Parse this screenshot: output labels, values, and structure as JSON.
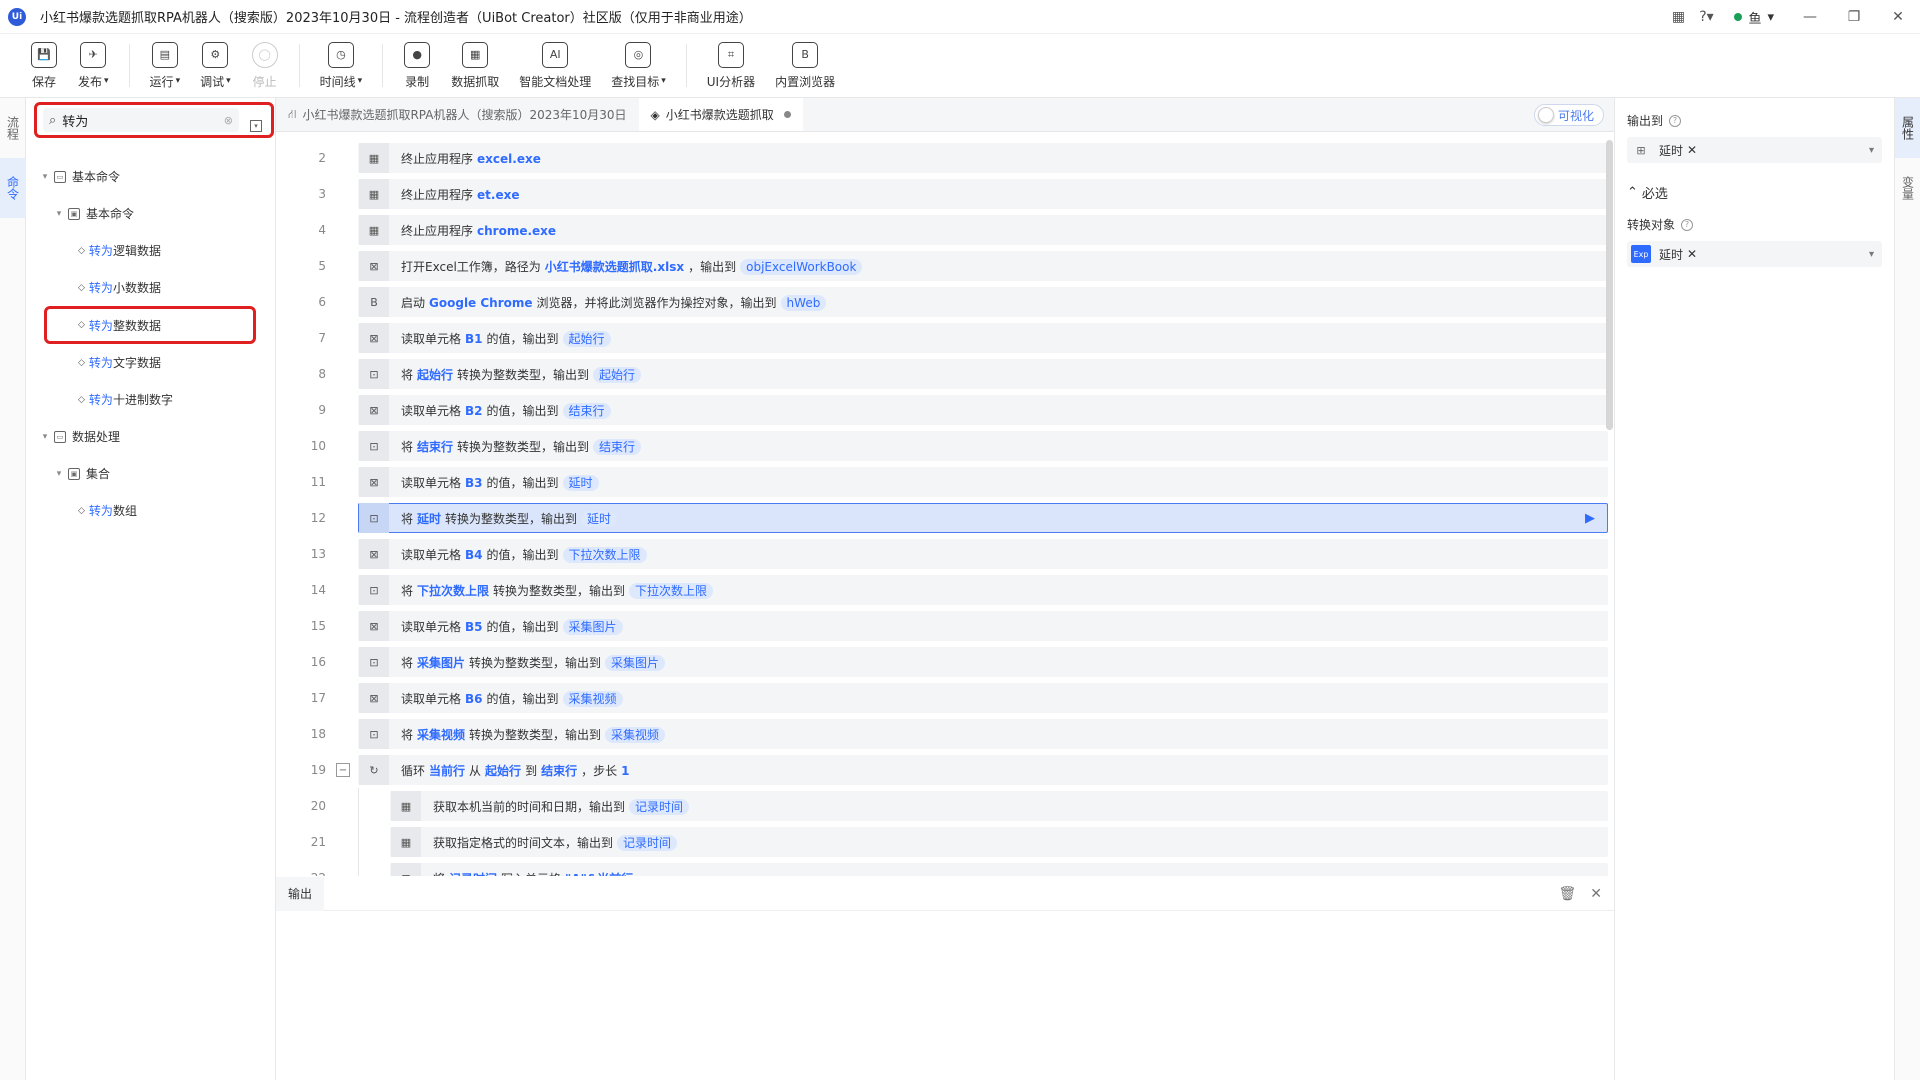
{
  "window": {
    "logo": "Ui",
    "title": "小红书爆款选题抓取RPA机器人（搜索版）2023年10月30日 - 流程创造者（UiBot Creator）社区版（仅用于非商业用途）",
    "user": "鱼"
  },
  "toolbar": {
    "items": [
      {
        "label": "保存",
        "icon": "save-icon",
        "caret": false,
        "disabled": false
      },
      {
        "label": "发布",
        "icon": "send-icon",
        "caret": true,
        "disabled": false
      },
      {
        "sep": true
      },
      {
        "label": "运行",
        "icon": "run-icon",
        "caret": true,
        "disabled": false
      },
      {
        "label": "调试",
        "icon": "debug-icon",
        "caret": true,
        "disabled": false
      },
      {
        "label": "停止",
        "icon": "stop-icon",
        "caret": false,
        "disabled": true
      },
      {
        "sep": true
      },
      {
        "label": "时间线",
        "icon": "clock-icon",
        "caret": true,
        "disabled": false
      },
      {
        "sep": true
      },
      {
        "label": "录制",
        "icon": "record-icon",
        "caret": false,
        "disabled": false
      },
      {
        "label": "数据抓取",
        "icon": "data-grab-icon",
        "caret": false,
        "disabled": false
      },
      {
        "label": "智能文档处理",
        "icon": "ai-doc-icon",
        "caret": false,
        "disabled": false
      },
      {
        "label": "查找目标",
        "icon": "find-target-icon",
        "caret": true,
        "disabled": false
      },
      {
        "sep": true
      },
      {
        "label": "UI分析器",
        "icon": "ui-analyzer-icon",
        "caret": false,
        "disabled": false
      },
      {
        "label": "内置浏览器",
        "icon": "browser-icon",
        "caret": false,
        "disabled": false
      }
    ]
  },
  "left_strip": {
    "tabs": [
      "流程",
      "命令"
    ]
  },
  "search": {
    "value": "转为"
  },
  "tree": [
    {
      "level": 0,
      "type": "group",
      "label": "基本命令",
      "expanded": true
    },
    {
      "level": 1,
      "type": "group",
      "label": "基本命令",
      "expanded": true
    },
    {
      "level": 2,
      "type": "leaf",
      "hl": "转为",
      "rest": "逻辑数据"
    },
    {
      "level": 2,
      "type": "leaf",
      "hl": "转为",
      "rest": "小数数据"
    },
    {
      "level": 2,
      "type": "leaf",
      "hl": "转为",
      "rest": "整数数据",
      "boxed": true
    },
    {
      "level": 2,
      "type": "leaf",
      "hl": "转为",
      "rest": "文字数据"
    },
    {
      "level": 2,
      "type": "leaf",
      "hl": "转为",
      "rest": "十进制数字"
    },
    {
      "level": 0,
      "type": "group",
      "label": "数据处理",
      "expanded": true
    },
    {
      "level": 1,
      "type": "group",
      "label": "集合",
      "expanded": true
    },
    {
      "level": 2,
      "type": "leaf",
      "hl": "转为",
      "rest": "数组"
    }
  ],
  "tabs": [
    {
      "label": "小红书爆款选题抓取RPA机器人（搜索版）2023年10月30日",
      "active": false,
      "dot": false
    },
    {
      "label": "小红书爆款选题抓取",
      "active": true,
      "dot": true
    }
  ],
  "visual_toggle": {
    "label": "可视化"
  },
  "lines": [
    {
      "n": 2,
      "icon": "app-icon",
      "parts": [
        [
          "t",
          "终止应用程序"
        ],
        [
          "k",
          "excel.exe"
        ]
      ]
    },
    {
      "n": 3,
      "icon": "app-icon",
      "parts": [
        [
          "t",
          "终止应用程序"
        ],
        [
          "k",
          "et.exe"
        ]
      ]
    },
    {
      "n": 4,
      "icon": "app-icon",
      "parts": [
        [
          "t",
          "终止应用程序"
        ],
        [
          "k",
          "chrome.exe"
        ]
      ]
    },
    {
      "n": 5,
      "icon": "excel-icon",
      "parts": [
        [
          "t",
          "打开Excel工作簿，路径为"
        ],
        [
          "k",
          "小红书爆款选题抓取.xlsx"
        ],
        [
          "t",
          "，输出到"
        ],
        [
          "v",
          "objExcelWorkBook"
        ]
      ]
    },
    {
      "n": 6,
      "icon": "browser-icon",
      "parts": [
        [
          "t",
          "启动"
        ],
        [
          "k",
          "Google Chrome"
        ],
        [
          "t",
          "浏览器，并将此浏览器作为操控对象，输出到"
        ],
        [
          "v",
          "hWeb"
        ]
      ]
    },
    {
      "n": 7,
      "icon": "excel-icon",
      "parts": [
        [
          "t",
          "读取单元格"
        ],
        [
          "k",
          "B1"
        ],
        [
          "t",
          "的值，输出到"
        ],
        [
          "v",
          "起始行"
        ]
      ]
    },
    {
      "n": 8,
      "icon": "convert-icon",
      "parts": [
        [
          "t",
          "将"
        ],
        [
          "k",
          "起始行"
        ],
        [
          "t",
          "转换为整数类型，输出到"
        ],
        [
          "v",
          "起始行"
        ]
      ]
    },
    {
      "n": 9,
      "icon": "excel-icon",
      "parts": [
        [
          "t",
          "读取单元格"
        ],
        [
          "k",
          "B2"
        ],
        [
          "t",
          "的值，输出到"
        ],
        [
          "v",
          "结束行"
        ]
      ]
    },
    {
      "n": 10,
      "icon": "convert-icon",
      "parts": [
        [
          "t",
          "将"
        ],
        [
          "k",
          "结束行"
        ],
        [
          "t",
          "转换为整数类型，输出到"
        ],
        [
          "v",
          "结束行"
        ]
      ]
    },
    {
      "n": 11,
      "icon": "excel-icon",
      "parts": [
        [
          "t",
          "读取单元格"
        ],
        [
          "k",
          "B3"
        ],
        [
          "t",
          "的值，输出到"
        ],
        [
          "v",
          "延时"
        ]
      ]
    },
    {
      "n": 12,
      "icon": "convert-icon",
      "selected": true,
      "parts": [
        [
          "t",
          "将"
        ],
        [
          "k",
          "延时"
        ],
        [
          "t",
          "转换为整数类型，输出到"
        ],
        [
          "v",
          "延时"
        ]
      ]
    },
    {
      "n": 13,
      "icon": "excel-icon",
      "parts": [
        [
          "t",
          "读取单元格"
        ],
        [
          "k",
          "B4"
        ],
        [
          "t",
          "的值，输出到"
        ],
        [
          "v",
          "下拉次数上限"
        ]
      ]
    },
    {
      "n": 14,
      "icon": "convert-icon",
      "parts": [
        [
          "t",
          "将"
        ],
        [
          "k",
          "下拉次数上限"
        ],
        [
          "t",
          "转换为整数类型，输出到"
        ],
        [
          "v",
          "下拉次数上限"
        ]
      ]
    },
    {
      "n": 15,
      "icon": "excel-icon",
      "parts": [
        [
          "t",
          "读取单元格"
        ],
        [
          "k",
          "B5"
        ],
        [
          "t",
          "的值，输出到"
        ],
        [
          "v",
          "采集图片"
        ]
      ]
    },
    {
      "n": 16,
      "icon": "convert-icon",
      "parts": [
        [
          "t",
          "将"
        ],
        [
          "k",
          "采集图片"
        ],
        [
          "t",
          "转换为整数类型，输出到"
        ],
        [
          "v",
          "采集图片"
        ]
      ]
    },
    {
      "n": 17,
      "icon": "excel-icon",
      "parts": [
        [
          "t",
          "读取单元格"
        ],
        [
          "k",
          "B6"
        ],
        [
          "t",
          "的值，输出到"
        ],
        [
          "v",
          "采集视频"
        ]
      ]
    },
    {
      "n": 18,
      "icon": "convert-icon",
      "parts": [
        [
          "t",
          "将"
        ],
        [
          "k",
          "采集视频"
        ],
        [
          "t",
          "转换为整数类型，输出到"
        ],
        [
          "v",
          "采集视频"
        ]
      ]
    },
    {
      "n": 19,
      "icon": "loop-icon",
      "fold": true,
      "parts": [
        [
          "t",
          "循环"
        ],
        [
          "k",
          "当前行"
        ],
        [
          "t",
          "从"
        ],
        [
          "k",
          "起始行"
        ],
        [
          "t",
          "到"
        ],
        [
          "k",
          "结束行"
        ],
        [
          "t",
          "，步长"
        ],
        [
          "k",
          "1"
        ]
      ]
    },
    {
      "n": 20,
      "icon": "calendar-icon",
      "indent": true,
      "parts": [
        [
          "t",
          "获取本机当前的时间和日期，输出到"
        ],
        [
          "v",
          "记录时间"
        ]
      ]
    },
    {
      "n": 21,
      "icon": "calendar-icon",
      "indent": true,
      "parts": [
        [
          "t",
          "获取指定格式的时间文本，输出到"
        ],
        [
          "v",
          "记录时间"
        ]
      ]
    },
    {
      "n": 22,
      "icon": "excel-icon",
      "indent": true,
      "parts": [
        [
          "t",
          "将"
        ],
        [
          "k",
          "记录时间"
        ],
        [
          "t",
          "写入单元格"
        ],
        [
          "k",
          "\"A\"&当前行"
        ]
      ]
    }
  ],
  "output": {
    "label": "输出"
  },
  "props": {
    "output_to": {
      "label": "输出到",
      "value": "延时"
    },
    "section": "必选",
    "convert_obj": {
      "label": "转换对象",
      "badge": "Exp",
      "value": "延时"
    }
  },
  "right_strip": {
    "tabs": [
      "属性",
      "变量"
    ]
  }
}
